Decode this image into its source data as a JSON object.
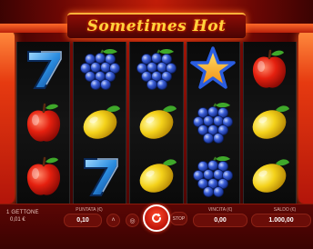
{
  "game": {
    "title": "Sometimes Hot"
  },
  "reels": [
    [
      "seven",
      "apple",
      "apple"
    ],
    [
      "grapes",
      "lemon",
      "seven"
    ],
    [
      "grapes",
      "lemon",
      "lemon"
    ],
    [
      "star",
      "grapes",
      "grapes"
    ],
    [
      "apple",
      "lemon",
      "lemon"
    ]
  ],
  "footer": {
    "coin_label": "1 GETTONE",
    "coin_value": "0,01 €",
    "bet_label": "PUNTATA (€)",
    "bet_value": "0,10",
    "win_label": "VINCITA (€)",
    "win_value": "0,00",
    "balance_label": "SALDO (€)",
    "balance_value": "1.000,00",
    "stop_label": "STOP"
  },
  "colors": {
    "accent": "#ffd23c",
    "background": "#6a0704",
    "spin": "#e0200e"
  }
}
